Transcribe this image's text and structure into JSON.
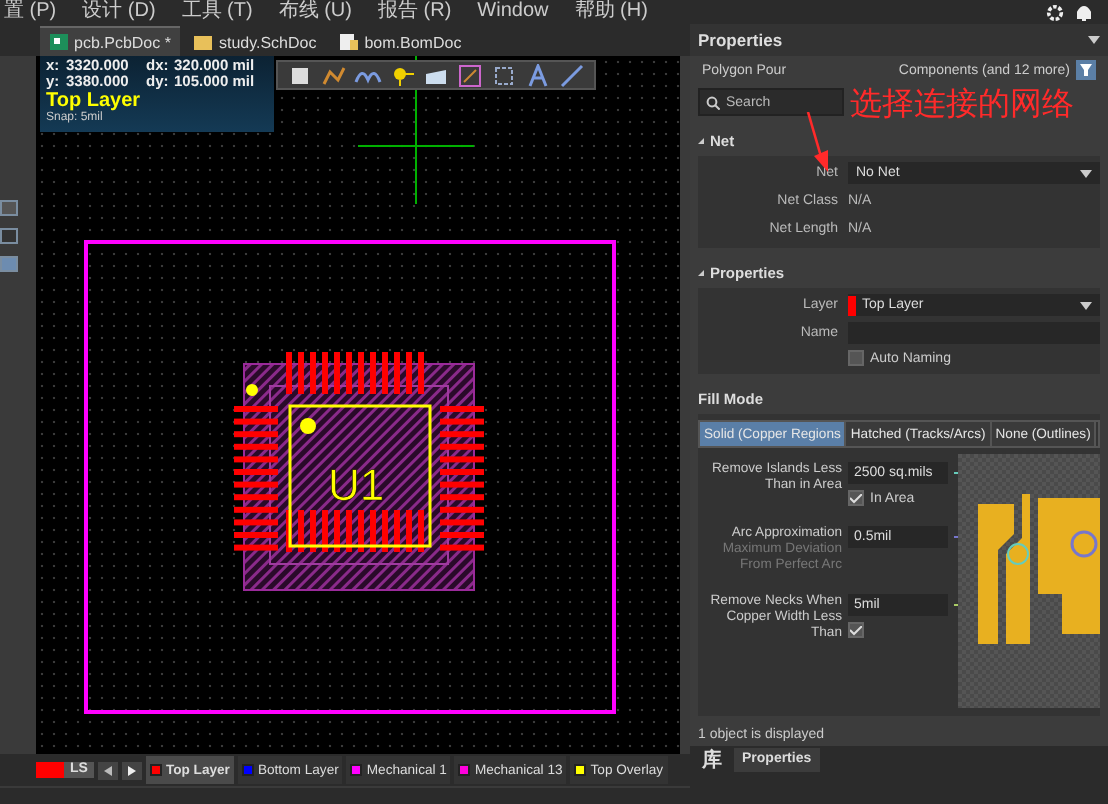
{
  "menu": [
    "置 (P)",
    "设计 (D)",
    "工具 (T)",
    "布线 (U)",
    "报告 (R)",
    "Window",
    "帮助 (H)"
  ],
  "doc_tabs": [
    {
      "label": "pcb.PcbDoc *",
      "kind": "pcb",
      "selected": true
    },
    {
      "label": "study.SchDoc",
      "kind": "sch",
      "selected": false
    },
    {
      "label": "bom.BomDoc",
      "kind": "bom",
      "selected": false
    }
  ],
  "canvas": {
    "readout": [
      {
        "axis": "x:",
        "value": "3320.000",
        "delta_axis": "dx:",
        "delta": "320.000 mil"
      },
      {
        "axis": "y:",
        "value": "3380.000",
        "delta_axis": "dy:",
        "delta": "105.000 mil"
      }
    ],
    "layer": "Top Layer",
    "snap": "Snap: 5mil",
    "designator": "U1"
  },
  "layer_bar": {
    "current": "LS",
    "layers": [
      {
        "label": "Top Layer",
        "color": "#ff0000",
        "selected": true
      },
      {
        "label": "Bottom Layer",
        "color": "#0000ff",
        "selected": false
      },
      {
        "label": "Mechanical 1",
        "color": "#ff00ff",
        "selected": false
      },
      {
        "label": "Mechanical 13",
        "color": "#ff00dd",
        "selected": false
      },
      {
        "label": "Top Overlay",
        "color": "#ffff00",
        "selected": false
      }
    ]
  },
  "panel": {
    "title": "Properties",
    "object": "Polygon Pour",
    "filter": "Components (and 12 more)",
    "search": {
      "placeholder": "Search"
    },
    "annotation": "选择连接的网络",
    "net": {
      "title": "Net",
      "fields": [
        {
          "label": "Net",
          "value": "No Net",
          "kind": "dropdown"
        },
        {
          "label": "Net Class",
          "value": "N/A",
          "kind": "text"
        },
        {
          "label": "Net Length",
          "value": "N/A",
          "kind": "text"
        }
      ]
    },
    "properties": {
      "title": "Properties",
      "layer": {
        "label": "Layer",
        "value": "Top Layer",
        "color": "#ff0000"
      },
      "name": {
        "label": "Name"
      },
      "auto_naming": {
        "label": "Auto Naming",
        "checked": false
      }
    },
    "fill_mode": {
      "title": "Fill Mode",
      "options": [
        {
          "label": "Solid (Copper Regions",
          "selected": true
        },
        {
          "label": "Hatched (Tracks/Arcs)",
          "selected": false
        },
        {
          "label": "None (Outlines)",
          "selected": false
        }
      ],
      "rules": [
        {
          "label": "Remove Islands Less Than in Area",
          "value": "2500 sq.mils",
          "checkbox": {
            "label": "In Area",
            "checked": true
          }
        },
        {
          "label": "Arc Approximation",
          "sublabel": "Maximum Deviation From Perfect Arc",
          "value": "0.5mil"
        },
        {
          "label": "Remove Necks When Copper Width Less Than",
          "value": "5mil",
          "checkbox": {
            "checked": true
          }
        }
      ]
    },
    "status": "1 object is displayed",
    "tabs": [
      {
        "label": "库",
        "selected": false
      },
      {
        "label": "Properties",
        "selected": true
      }
    ]
  }
}
